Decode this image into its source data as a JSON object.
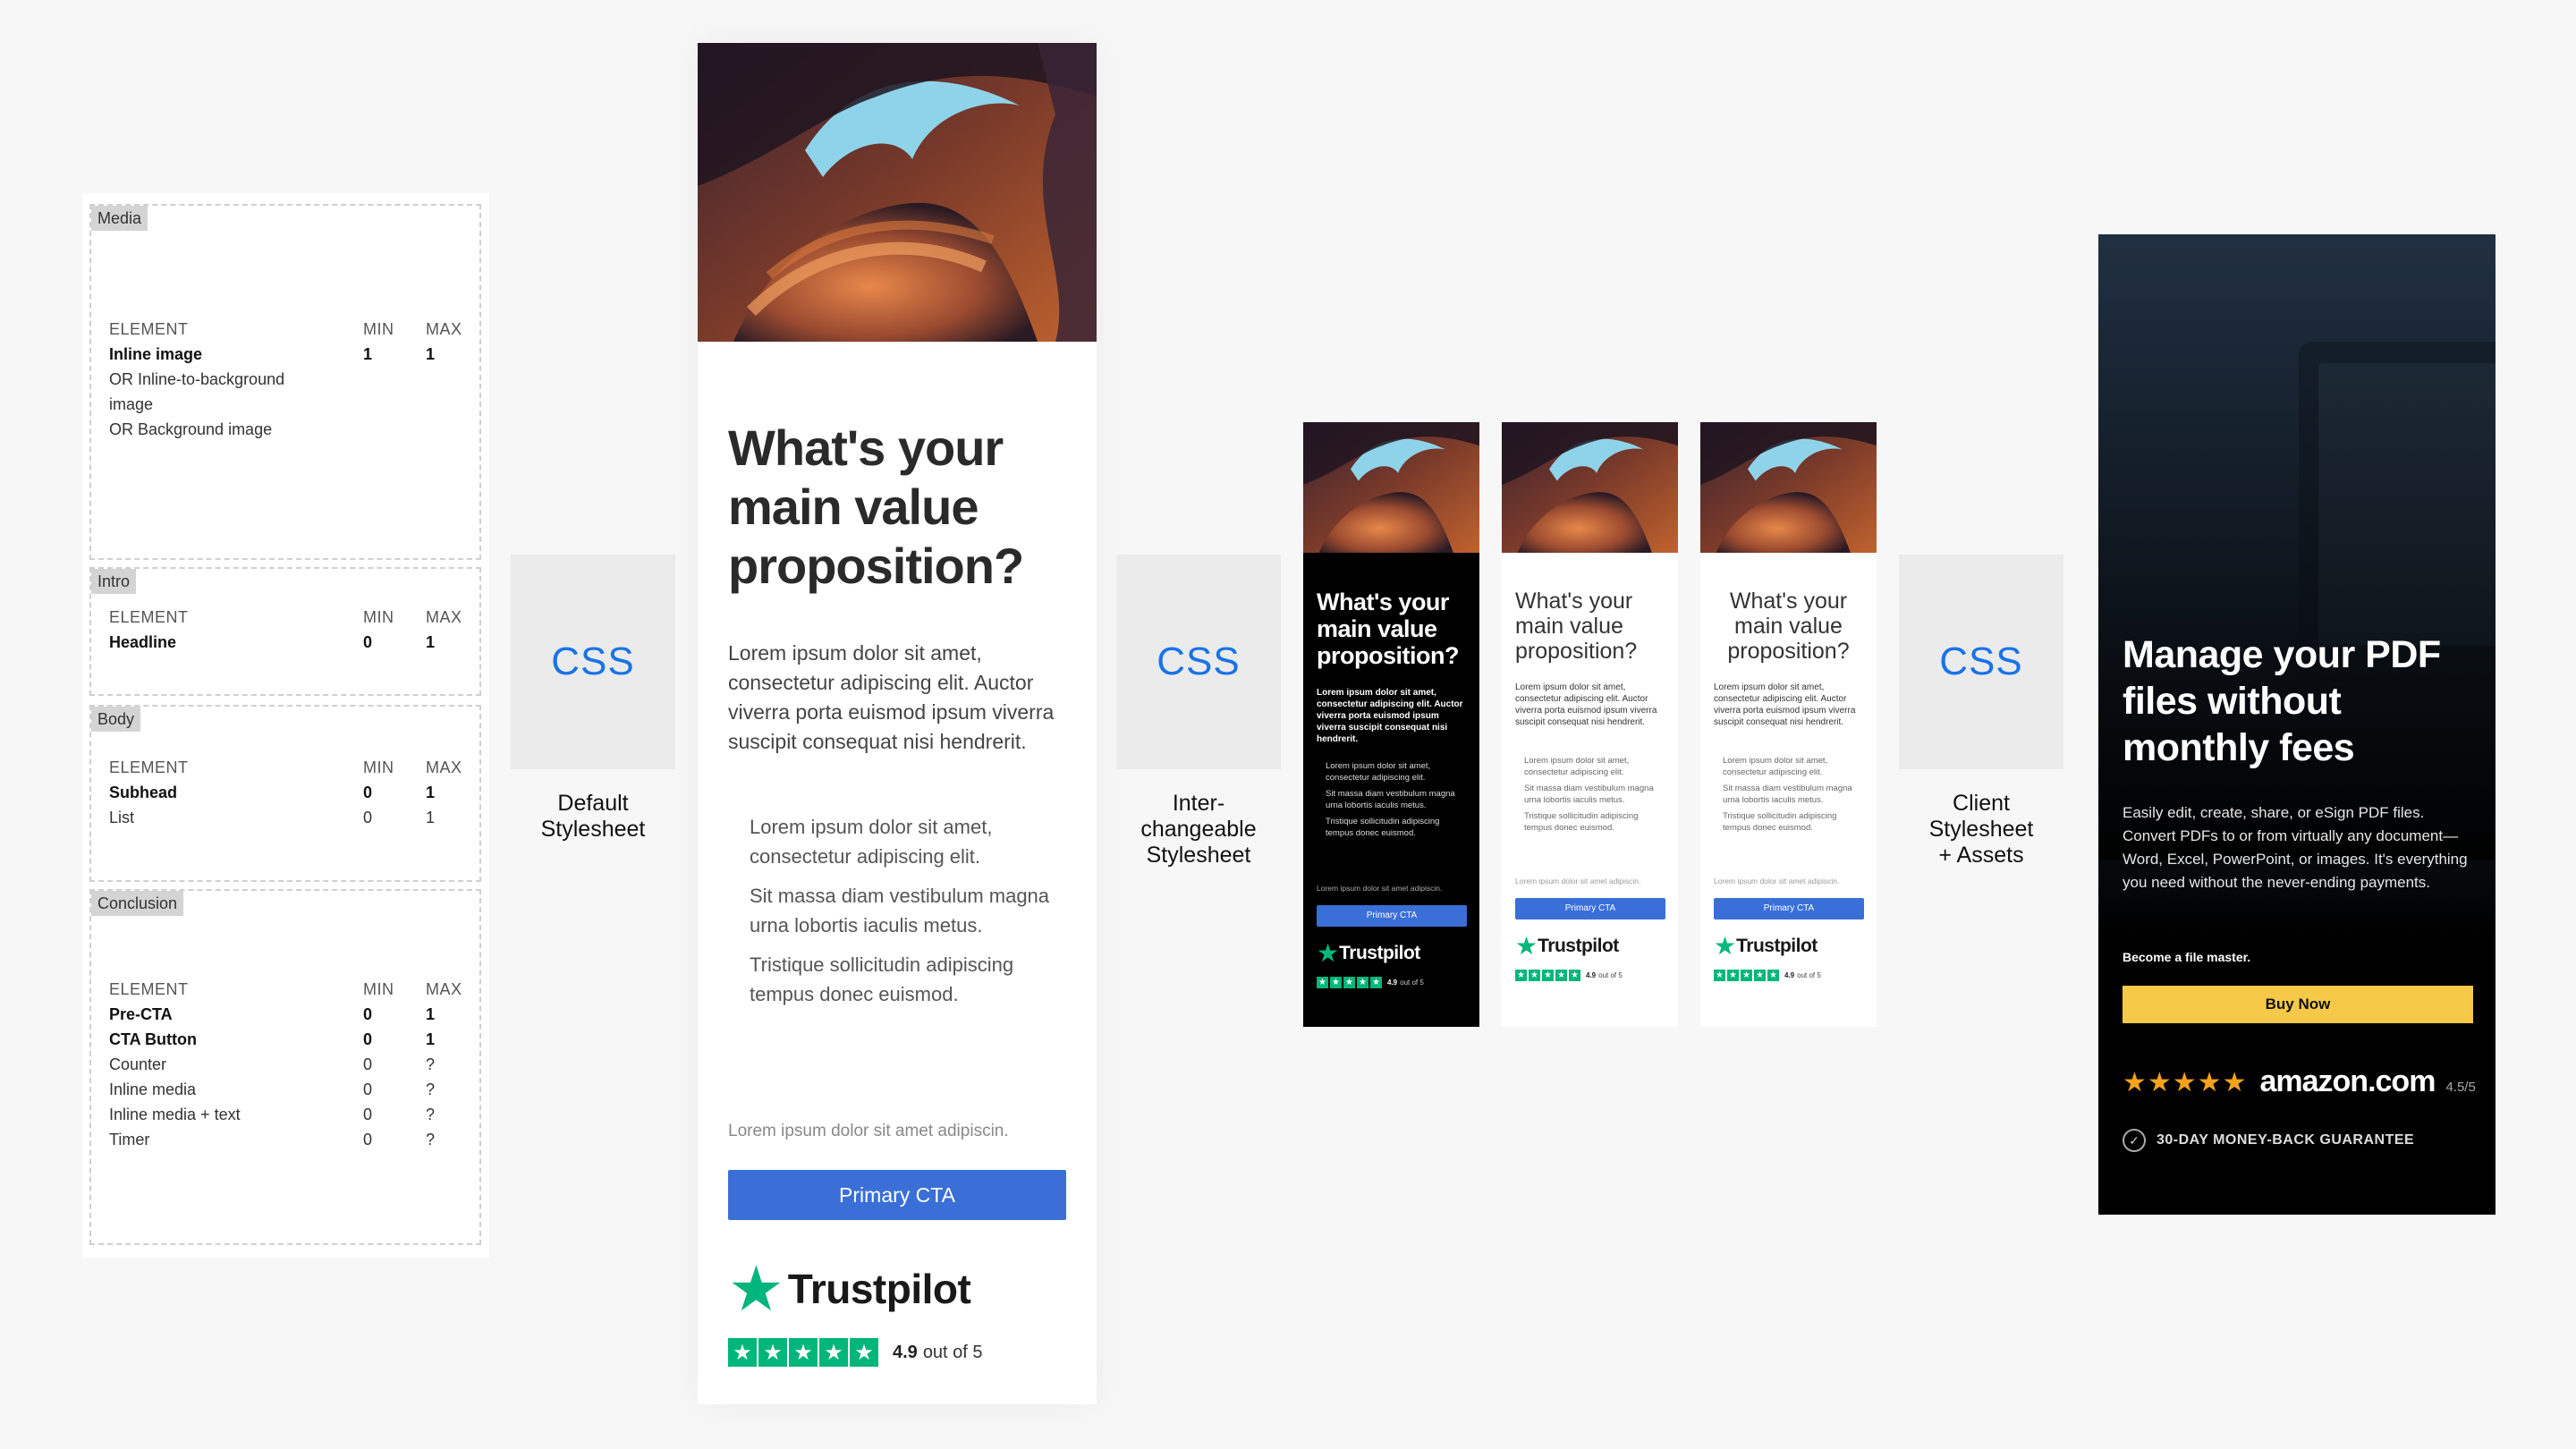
{
  "spec": {
    "sections": [
      {
        "tag": "Media",
        "headers": [
          "ELEMENT",
          "MIN",
          "MAX"
        ],
        "rows": [
          {
            "element": "Inline image",
            "min": "1",
            "max": "1",
            "bold": true
          },
          {
            "element": "OR Inline-to-background image",
            "min": "",
            "max": "",
            "bold": false
          },
          {
            "element": "OR Background image",
            "min": "",
            "max": "",
            "bold": false
          }
        ]
      },
      {
        "tag": "Intro",
        "headers": [
          "ELEMENT",
          "MIN",
          "MAX"
        ],
        "rows": [
          {
            "element": "Headline",
            "min": "0",
            "max": "1",
            "bold": true
          }
        ]
      },
      {
        "tag": "Body",
        "headers": [
          "ELEMENT",
          "MIN",
          "MAX"
        ],
        "rows": [
          {
            "element": "Subhead",
            "min": "0",
            "max": "1",
            "bold": true
          },
          {
            "element": "List",
            "min": "0",
            "max": "1",
            "bold": false
          }
        ]
      },
      {
        "tag": "Conclusion",
        "headers": [
          "ELEMENT",
          "MIN",
          "MAX"
        ],
        "rows": [
          {
            "element": "Pre-CTA",
            "min": "0",
            "max": "1",
            "bold": true
          },
          {
            "element": "CTA Button",
            "min": "0",
            "max": "1",
            "bold": true
          },
          {
            "element": "Counter",
            "min": "0",
            "max": "?",
            "bold": false
          },
          {
            "element": "Inline media",
            "min": "0",
            "max": "?",
            "bold": false
          },
          {
            "element": "Inline media + text",
            "min": "0",
            "max": "?",
            "bold": false
          },
          {
            "element": "Timer",
            "min": "0",
            "max": "?",
            "bold": false
          }
        ]
      }
    ]
  },
  "css_blocks": [
    {
      "label": "CSS",
      "caption_lines": [
        "Default",
        "Stylesheet"
      ]
    },
    {
      "label": "CSS",
      "caption_lines": [
        "Inter-",
        "changeable",
        "Stylesheet"
      ]
    },
    {
      "label": "CSS",
      "caption_lines": [
        "Client",
        "Stylesheet",
        "+ Assets"
      ]
    }
  ],
  "ad": {
    "headline": "What's your main value proposition?",
    "subhead": "Lorem ipsum dolor sit amet, consectetur adipiscing elit. Auctor viverra porta euismod ipsum viverra suscipit consequat nisi hendrerit.",
    "bullets": [
      "Lorem ipsum dolor sit amet, consectetur adipiscing elit.",
      "Sit massa diam vestibulum magna urna lobortis iaculis metus.",
      "Tristique sollicitudin adipiscing tempus donec euismod."
    ],
    "pre_cta": "Lorem ipsum dolor sit amet adipiscin.",
    "cta": "Primary CTA",
    "trustpilot": {
      "brand": "Trustpilot",
      "score": "4.9",
      "out_of": "out of 5"
    }
  },
  "client_ad": {
    "headline": "Manage your PDF files without monthly fees",
    "body": "Easily edit, create, share, or eSign PDF files. Convert PDFs to or from virtually any document—Word, Excel, PowerPoint, or images. It's everything you need without the never-ending payments.",
    "pre_cta": "Become a file master.",
    "cta": "Buy Now",
    "stars": "★★★★★",
    "brand": "amazon.com",
    "rating": "4.5/5",
    "guarantee": "30-DAY MONEY-BACK GUARANTEE"
  },
  "colors": {
    "accent": "#1a73e8",
    "cta": "#3a6fd8",
    "trustpilot": "#00b67a",
    "buy": "#f7c948",
    "amazon_star": "#f6a21a"
  }
}
